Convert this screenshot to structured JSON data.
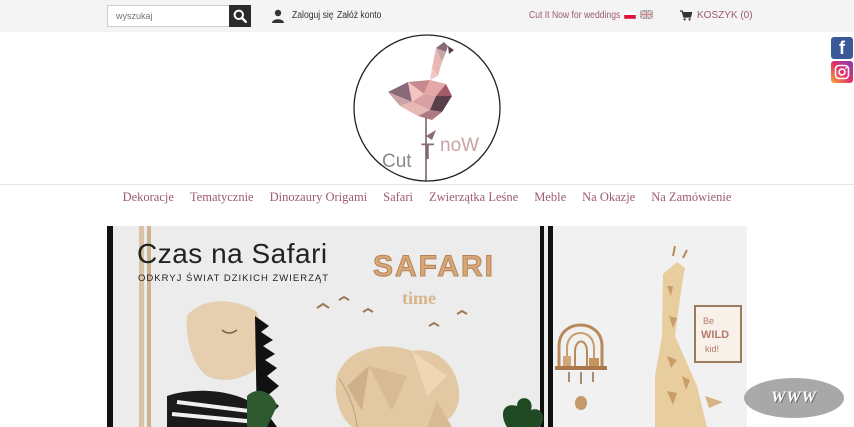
{
  "header": {
    "search": {
      "placeholder": "wyszukaj",
      "value": ""
    },
    "login_label": "Zaloguj się",
    "register_label": "Załóż konto",
    "weddings_label": "Cut It Now for weddings",
    "cart_label": "KOSZYK (0)"
  },
  "logo": {
    "word_cut": "Cut",
    "word_t": "T",
    "word_now": "noW"
  },
  "menu": {
    "items": [
      {
        "label": "Dekoracje"
      },
      {
        "label": "Tematycznie"
      },
      {
        "label": "Dinozaury Origami"
      },
      {
        "label": "Safari"
      },
      {
        "label": "Zwierzątka Leśne"
      },
      {
        "label": "Meble"
      },
      {
        "label": "Na Okazje"
      },
      {
        "label": "Na Zamówienie"
      }
    ]
  },
  "banner": {
    "title": "Czas na Safari",
    "subtitle": "ODKRYJ ŚWIAT DZIKICH ZWIERZĄT",
    "safari_word": "SAFARI",
    "time_word": "time",
    "sign_line1": "Be",
    "sign_line2": "WILD",
    "sign_line3": "kid!"
  },
  "badge": {
    "label": "WWW"
  },
  "colors": {
    "accent": "#9c5a6e",
    "facebook": "#3b5998",
    "dark": "#2b2b2b"
  },
  "icons": [
    "search-icon",
    "user-icon",
    "cart-icon",
    "facebook-icon",
    "instagram-icon"
  ]
}
